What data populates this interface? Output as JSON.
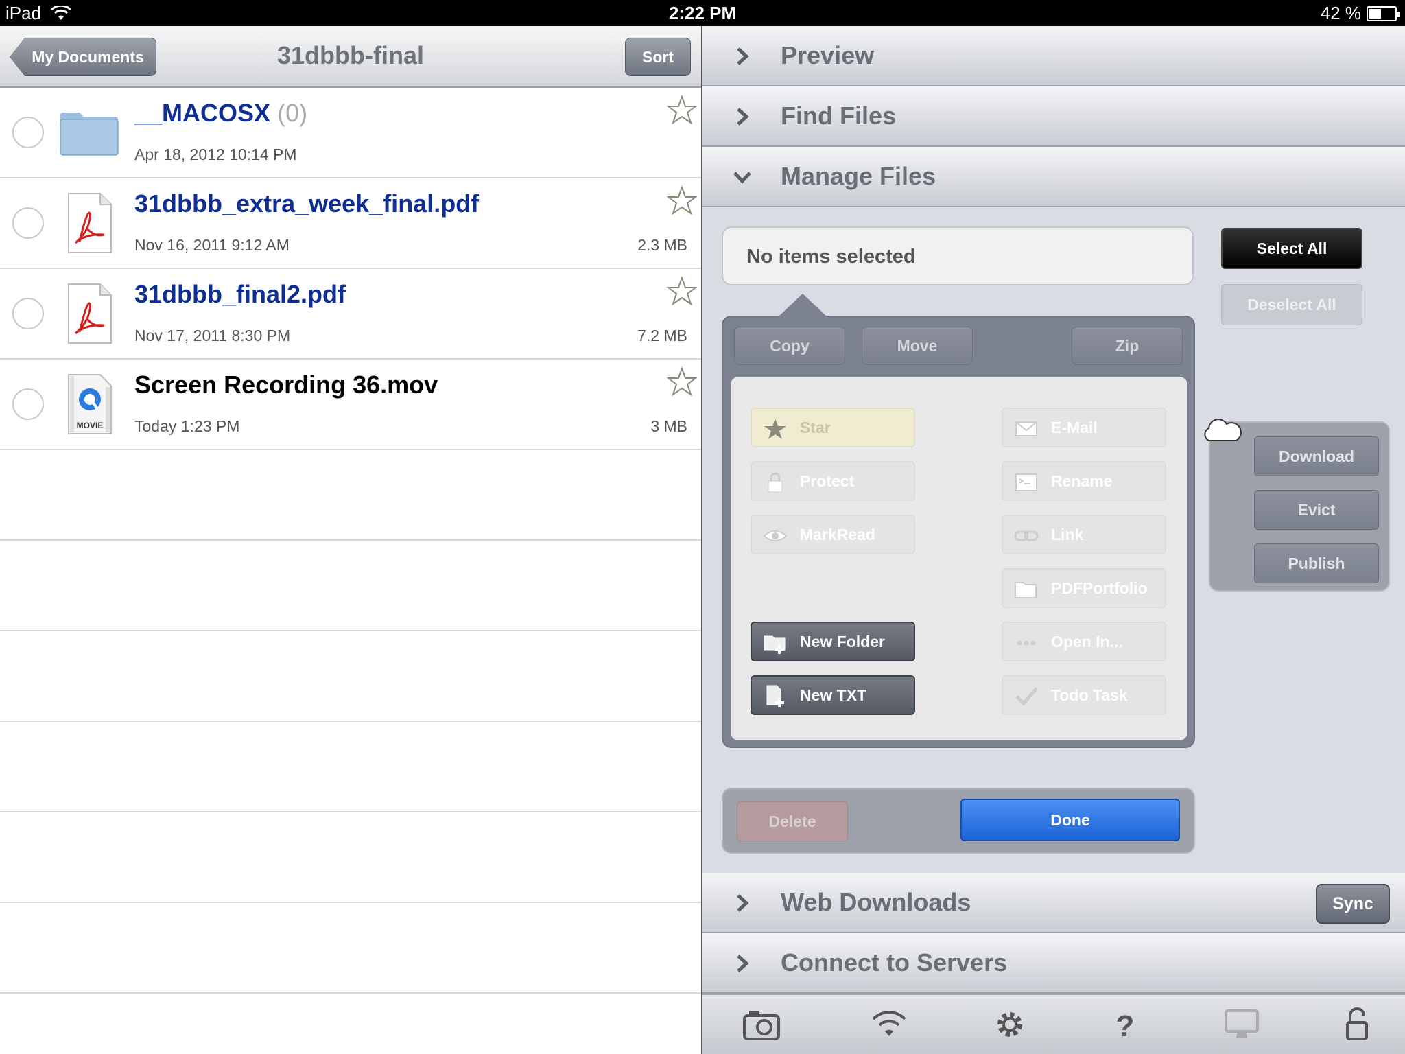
{
  "status_bar": {
    "device": "iPad",
    "time": "2:22 PM",
    "battery": "42 %",
    "battery_level": 0.42
  },
  "navbar": {
    "back_label": "My Documents",
    "title": "31dbbb-final",
    "sort_label": "Sort"
  },
  "files": [
    {
      "name": "__MACOSX",
      "count": "(0)",
      "date": "Apr 18, 2012 10:14 PM",
      "size": "",
      "type": "folder"
    },
    {
      "name": "31dbbb_extra_week_final.pdf",
      "count": "",
      "date": "Nov 16, 2011 9:12 AM",
      "size": "2.3 MB",
      "type": "pdf"
    },
    {
      "name": "31dbbb_final2.pdf",
      "count": "",
      "date": "Nov 17, 2011 8:30 PM",
      "size": "7.2 MB",
      "type": "pdf"
    },
    {
      "name": "Screen Recording 36.mov",
      "count": "",
      "date": "Today 1:23 PM",
      "size": "3 MB",
      "type": "movie",
      "movie_label": "MOVIE"
    }
  ],
  "sections": {
    "preview": "Preview",
    "find_files": "Find Files",
    "manage_files": "Manage Files",
    "web_downloads": "Web Downloads",
    "connect_servers": "Connect to Servers"
  },
  "manage": {
    "status": "No items selected",
    "select_all": "Select All",
    "deselect_all": "Deselect All",
    "tabs": {
      "copy": "Copy",
      "move": "Move",
      "zip": "Zip"
    },
    "actions": {
      "star": "Star",
      "protect": "Protect",
      "markread": "MarkRead",
      "new_folder": "New Folder",
      "new_txt": "New TXT",
      "email": "E-Mail",
      "rename": "Rename",
      "link": "Link",
      "pdfportfolio": "PDFPortfolio",
      "open_in": "Open In...",
      "todo_task": "Todo Task"
    },
    "cloud": {
      "download": "Download",
      "evict": "Evict",
      "publish": "Publish"
    },
    "delete": "Delete",
    "done": "Done"
  },
  "sync_label": "Sync",
  "toolbar_icons": [
    "camera-icon",
    "wifi-icon",
    "gear-icon",
    "help-icon",
    "monitor-icon",
    "lock-icon"
  ],
  "colors": {
    "accent_blue": "#1e64d8",
    "file_link": "#0e2e92"
  }
}
